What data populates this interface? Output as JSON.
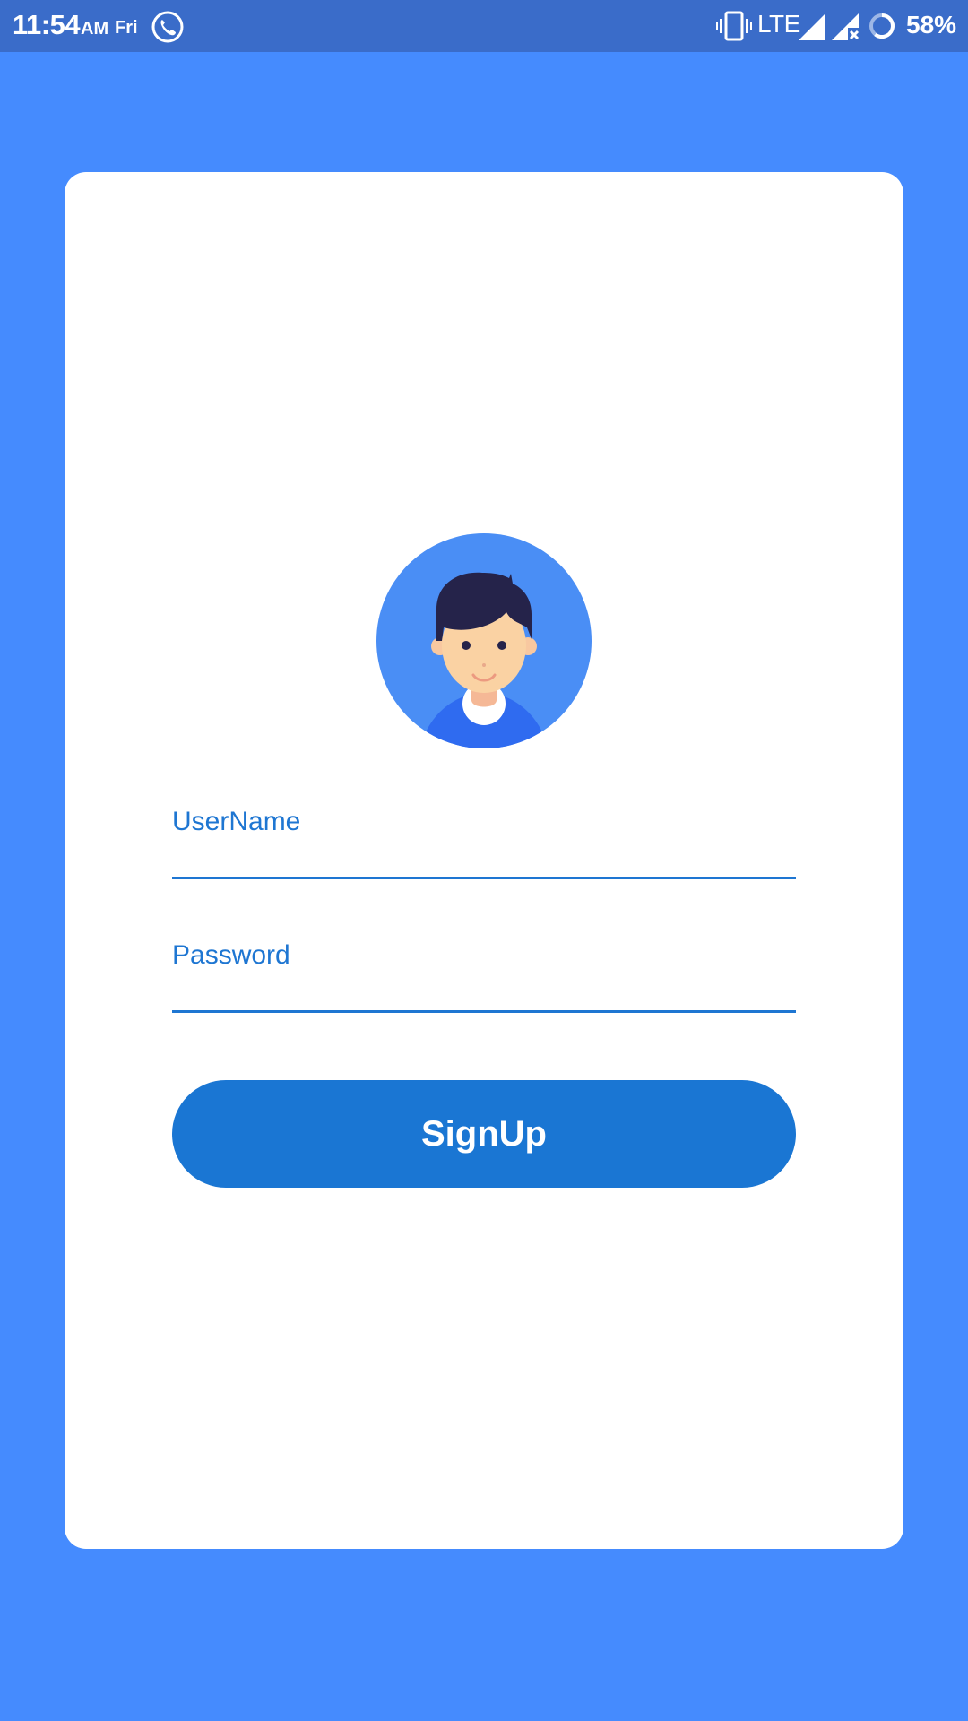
{
  "status_bar": {
    "time": "11:54",
    "ampm": "AM",
    "day": "Fri",
    "network": "LTE",
    "battery": "58%",
    "icons": [
      "call-icon",
      "vibrate-icon",
      "signal-icon",
      "signal-no-service-icon",
      "battery-icon"
    ]
  },
  "form": {
    "username_label": "UserName",
    "password_label": "Password",
    "signup_label": "SignUp",
    "avatar_icon": "user-avatar-icon"
  },
  "colors": {
    "background": "#458BFE",
    "status_bar": "#3A6CC9",
    "accent": "#1E76D2",
    "button": "#1A76D3",
    "card": "#FFFFFF"
  }
}
